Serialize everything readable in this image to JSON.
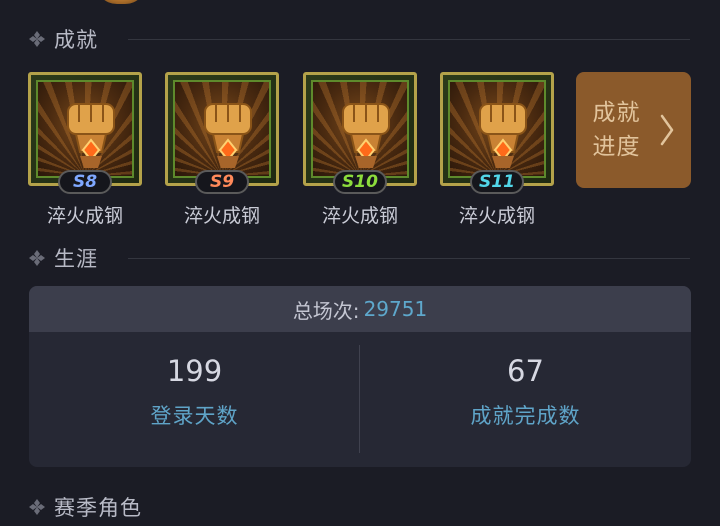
{
  "sections": {
    "achievements": {
      "title": "成就",
      "icon": "diamond-icon"
    },
    "career": {
      "title": "生涯",
      "icon": "diamond-icon"
    },
    "season_roles": {
      "title": "赛季角色",
      "icon": "diamond-icon"
    }
  },
  "badges": [
    {
      "season": "S8",
      "name": "淬火成钢",
      "tag_color": "#7fa8ff"
    },
    {
      "season": "S9",
      "name": "淬火成钢",
      "tag_color": "#ff8a5a"
    },
    {
      "season": "S10",
      "name": "淬火成钢",
      "tag_color": "#8cdc3c"
    },
    {
      "season": "S11",
      "name": "淬火成钢",
      "tag_color": "#52d6e8"
    }
  ],
  "progress_button": {
    "line1": "成就",
    "line2": "进度",
    "icon": "chevron-right-icon"
  },
  "career": {
    "total_label": "总场次:",
    "total_value": "29751",
    "stats": [
      {
        "value": "199",
        "label": "登录天数"
      },
      {
        "value": "67",
        "label": "成就完成数"
      }
    ]
  },
  "colors": {
    "background": "#1b1c25",
    "card": "#262834",
    "card_header": "#3c3e4c",
    "accent_blue": "#5ea8cc",
    "progress_button": "#8b5a2b"
  }
}
